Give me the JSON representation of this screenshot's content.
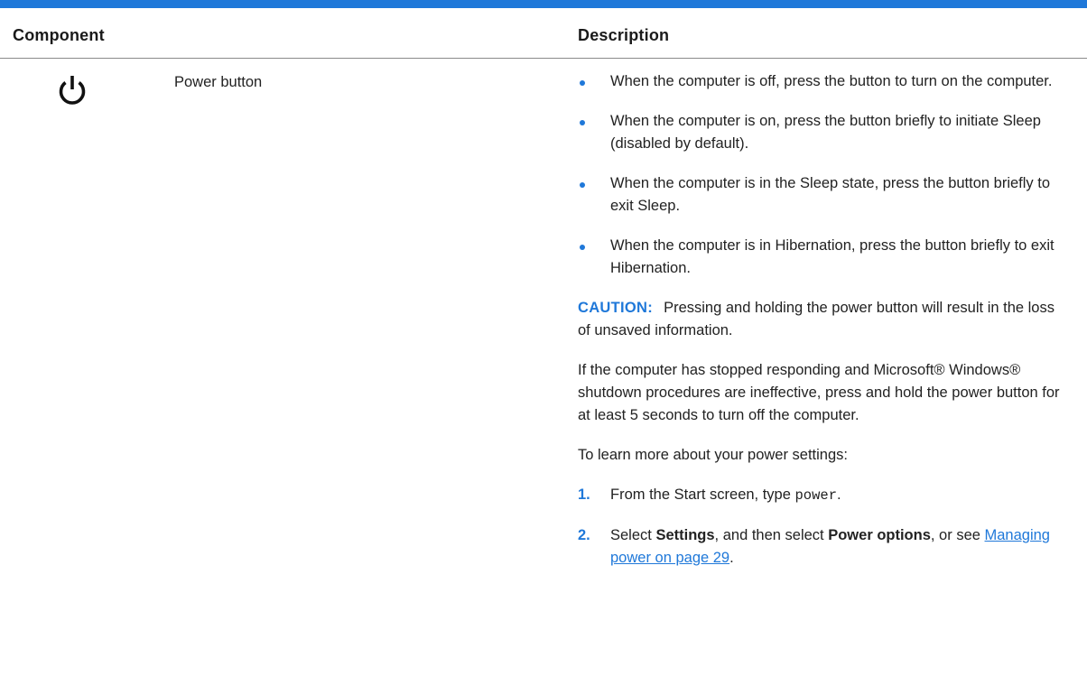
{
  "table": {
    "headers": {
      "component": "Component",
      "description": "Description"
    },
    "row": {
      "icon": "power-icon",
      "component_name": "Power button",
      "bullets": [
        "When the computer is off, press the button to turn on the computer.",
        "When the computer is on, press the button briefly to initiate Sleep (disabled by default).",
        "When the computer is in the Sleep state, press the button briefly to exit Sleep.",
        "When the computer is in Hibernation, press the button briefly to exit Hibernation."
      ],
      "caution": {
        "label": "CAUTION:",
        "text": "Pressing and holding the power button will result in the loss of unsaved information."
      },
      "note": "If the computer has stopped responding and Microsoft® Windows® shutdown procedures are ineffective, press and hold the power button for at least 5 seconds to turn off the computer.",
      "learn_more": "To learn more about your power settings:",
      "steps": [
        {
          "num": "1.",
          "pre": "From the Start screen, type ",
          "code": "power",
          "post": "."
        },
        {
          "num": "2.",
          "pre": "Select ",
          "bold1": "Settings",
          "mid": ", and then select ",
          "bold2": "Power options",
          "mid2": ", or see ",
          "link": "Managing power on page 29",
          "post": "."
        }
      ]
    }
  },
  "colors": {
    "accent": "#1f78d9",
    "text": "#222222",
    "rule": "#8a8a8a"
  }
}
